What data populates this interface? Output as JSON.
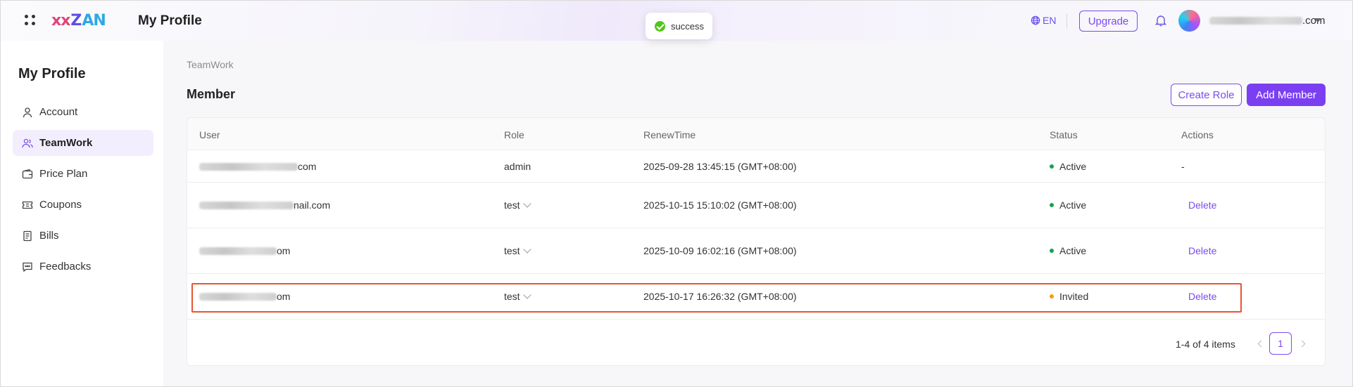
{
  "header": {
    "logo_parts": [
      "xx",
      "Z",
      "AN"
    ],
    "title": "My Profile",
    "language": "EN",
    "upgrade_label": "Upgrade",
    "user_email_suffix": ".com"
  },
  "toast": {
    "message": "success"
  },
  "sidebar": {
    "title": "My Profile",
    "items": [
      {
        "label": "Account",
        "icon": "user-icon"
      },
      {
        "label": "TeamWork",
        "icon": "team-icon",
        "active": true
      },
      {
        "label": "Price Plan",
        "icon": "wallet-icon"
      },
      {
        "label": "Coupons",
        "icon": "ticket-icon"
      },
      {
        "label": "Bills",
        "icon": "document-icon"
      },
      {
        "label": "Feedbacks",
        "icon": "chat-icon"
      }
    ]
  },
  "main": {
    "breadcrumb": "TeamWork",
    "section_title": "Member",
    "create_role_label": "Create Role",
    "add_member_label": "Add Member",
    "table": {
      "columns": [
        "User",
        "Role",
        "RenewTime",
        "Status",
        "Actions"
      ],
      "rows": [
        {
          "user_suffix": "com",
          "role": "admin",
          "renew_time": "2025-09-28 13:45:15 (GMT+08:00)",
          "status": "Active",
          "action": "-"
        },
        {
          "user_suffix": "nail.com",
          "role": "test",
          "renew_time": "2025-10-15 15:10:02 (GMT+08:00)",
          "status": "Active",
          "action": "Delete"
        },
        {
          "user_suffix": "om",
          "role": "test",
          "renew_time": "2025-10-09 16:02:16 (GMT+08:00)",
          "status": "Active",
          "action": "Delete"
        },
        {
          "user_suffix": "om",
          "role": "test",
          "renew_time": "2025-10-17 16:26:32 (GMT+08:00)",
          "status": "Invited",
          "action": "Delete"
        }
      ]
    },
    "pagination": {
      "total_text": "1-4 of 4 items",
      "current_page": "1"
    }
  },
  "colors": {
    "accent": "#7b3ff2",
    "active_status": "#16a34a",
    "invited_status": "#f59e0b",
    "highlight": "#e8542e"
  }
}
